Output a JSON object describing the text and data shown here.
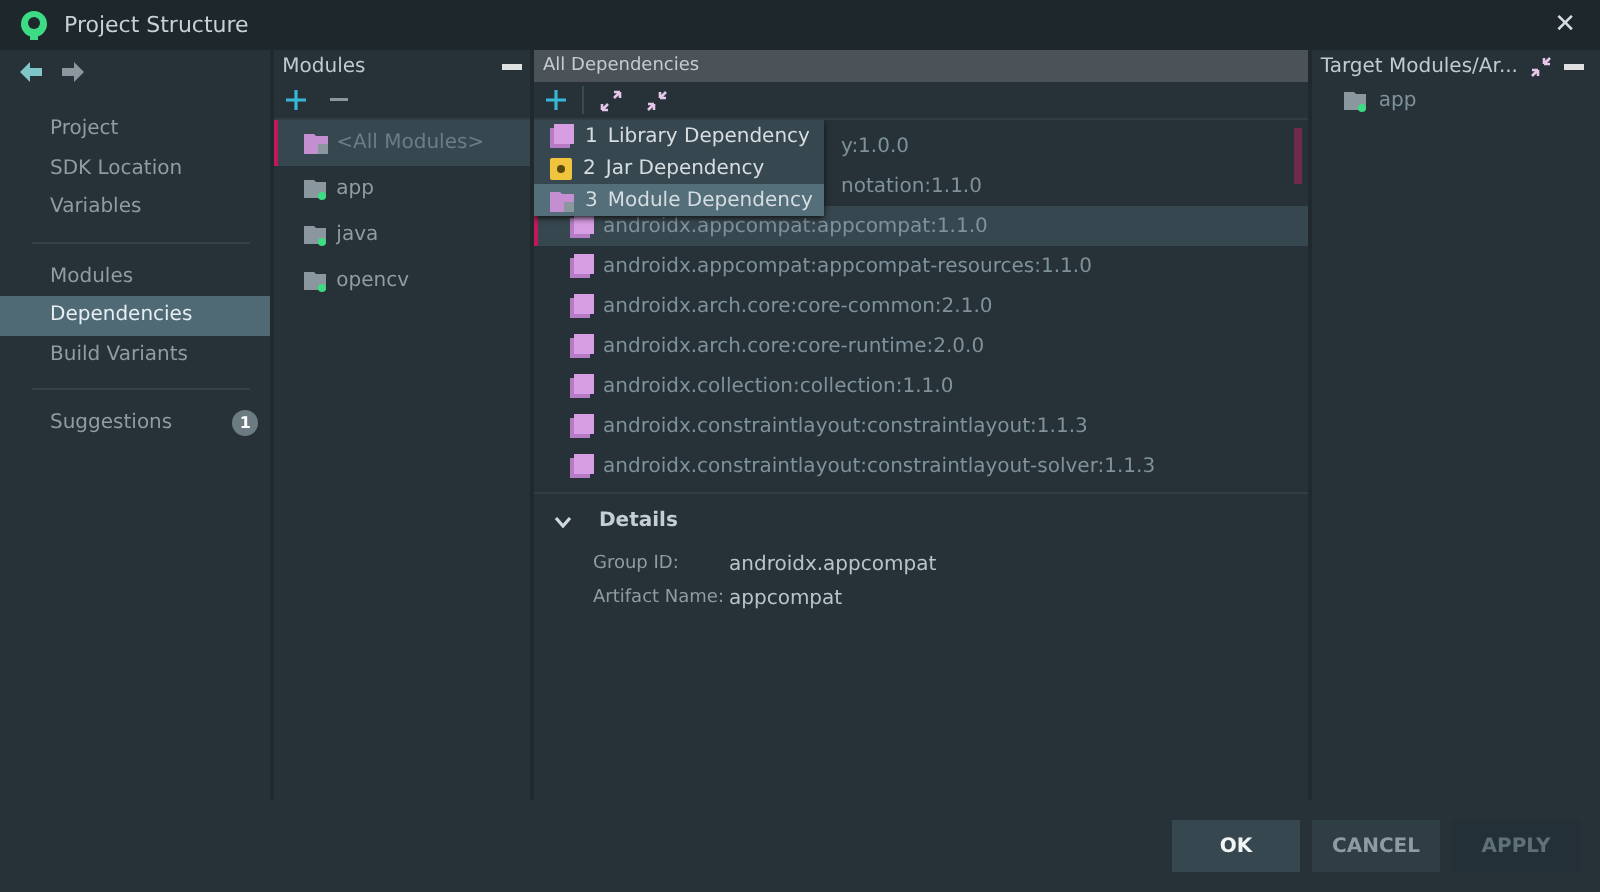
{
  "window": {
    "title": "Project Structure",
    "close": "✕"
  },
  "sidebar": {
    "groups": [
      {
        "items": [
          {
            "label": "Project",
            "selected": false
          },
          {
            "label": "SDK Location",
            "selected": false
          },
          {
            "label": "Variables",
            "selected": false
          }
        ]
      },
      {
        "items": [
          {
            "label": "Modules",
            "selected": false
          },
          {
            "label": "Dependencies",
            "selected": true
          },
          {
            "label": "Build Variants",
            "selected": false
          }
        ]
      },
      {
        "items": [
          {
            "label": "Suggestions",
            "selected": false,
            "badge": "1"
          }
        ]
      }
    ]
  },
  "modules": {
    "title": "Modules",
    "items": [
      {
        "label": "<All Modules>",
        "kind": "all",
        "selected": true
      },
      {
        "label": "app",
        "kind": "module",
        "selected": false
      },
      {
        "label": "java",
        "kind": "module",
        "selected": false
      },
      {
        "label": "opencv",
        "kind": "module",
        "selected": false
      }
    ]
  },
  "dependencies": {
    "title": "All Dependencies",
    "menu": [
      {
        "number": "1",
        "label": "Library Dependency",
        "kind": "library",
        "selected": false
      },
      {
        "number": "2",
        "label": "Jar Dependency",
        "kind": "jar",
        "selected": false
      },
      {
        "number": "3",
        "label": "Module Dependency",
        "kind": "module",
        "selected": true
      }
    ],
    "rows": [
      {
        "label": "y:1.0.0",
        "kind": "covered",
        "selected": false
      },
      {
        "label": "notation:1.1.0",
        "kind": "covered",
        "selected": false
      },
      {
        "label": "androidx.appcompat:appcompat:1.1.0",
        "kind": "library",
        "selected": true
      },
      {
        "label": "androidx.appcompat:appcompat-resources:1.1.0",
        "kind": "library",
        "selected": false
      },
      {
        "label": "androidx.arch.core:core-common:2.1.0",
        "kind": "library",
        "selected": false
      },
      {
        "label": "androidx.arch.core:core-runtime:2.0.0",
        "kind": "library",
        "selected": false
      },
      {
        "label": "androidx.collection:collection:1.1.0",
        "kind": "library",
        "selected": false
      },
      {
        "label": "androidx.constraintlayout:constraintlayout:1.1.3",
        "kind": "library",
        "selected": false
      },
      {
        "label": "androidx.constraintlayout:constraintlayout-solver:1.1.3",
        "kind": "library",
        "selected": false
      }
    ],
    "details": {
      "title": "Details",
      "expanded": true,
      "fields": [
        {
          "label": "Group ID:",
          "value": "androidx.appcompat"
        },
        {
          "label": "Artifact Name:",
          "value": "appcompat"
        }
      ]
    }
  },
  "target": {
    "title": "Target Modules/Ar...",
    "items": [
      {
        "label": "app"
      }
    ]
  },
  "buttons": [
    {
      "label": "OK",
      "disabled": false
    },
    {
      "label": "CANCEL",
      "disabled": false
    },
    {
      "label": "APPLY",
      "disabled": true
    }
  ]
}
